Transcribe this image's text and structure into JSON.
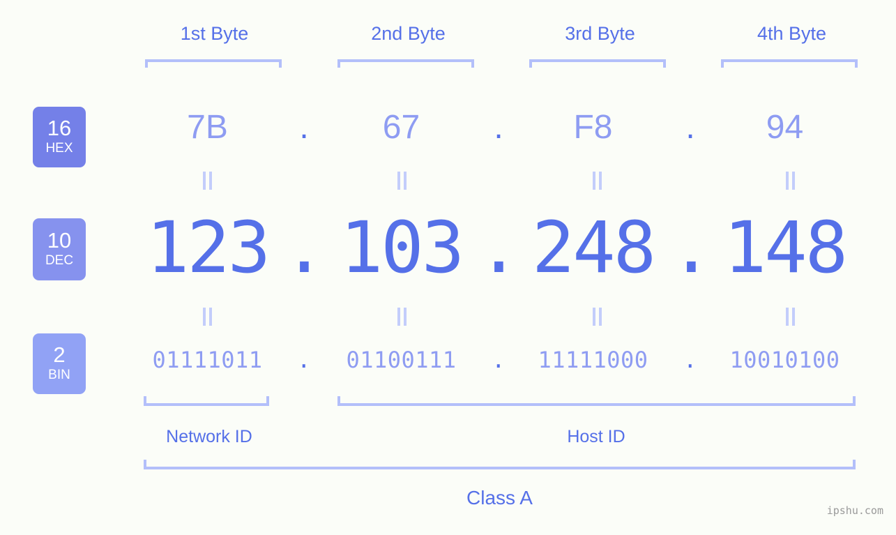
{
  "headers": [
    {
      "label": "1st Byte"
    },
    {
      "label": "2nd Byte"
    },
    {
      "label": "3rd Byte"
    },
    {
      "label": "4th Byte"
    }
  ],
  "bases": {
    "hex": {
      "radix": "16",
      "name": "HEX",
      "color": "#7480e8"
    },
    "dec": {
      "radix": "10",
      "name": "DEC",
      "color": "#8692ee"
    },
    "bin": {
      "radix": "2",
      "name": "BIN",
      "color": "#91a2f5"
    }
  },
  "rows": {
    "hex": {
      "values": [
        "7B",
        "67",
        "F8",
        "94"
      ],
      "separator": "."
    },
    "dec": {
      "values": [
        "123",
        "103",
        "248",
        "148"
      ],
      "separator": "."
    },
    "bin": {
      "values": [
        "01111011",
        "01100111",
        "11111000",
        "10010100"
      ],
      "separator": "."
    }
  },
  "equals_symbol": "=",
  "sections": {
    "network_id": "Network ID",
    "host_id": "Host ID",
    "class": "Class A"
  },
  "watermark": "ipshu.com",
  "colors": {
    "background": "#fbfdf8",
    "accent": "#5570e8",
    "accent_light": "#8e9cf2",
    "bracket": "#b3bffa",
    "equals": "#c3cdfb",
    "watermark": "#9a9a9a"
  }
}
